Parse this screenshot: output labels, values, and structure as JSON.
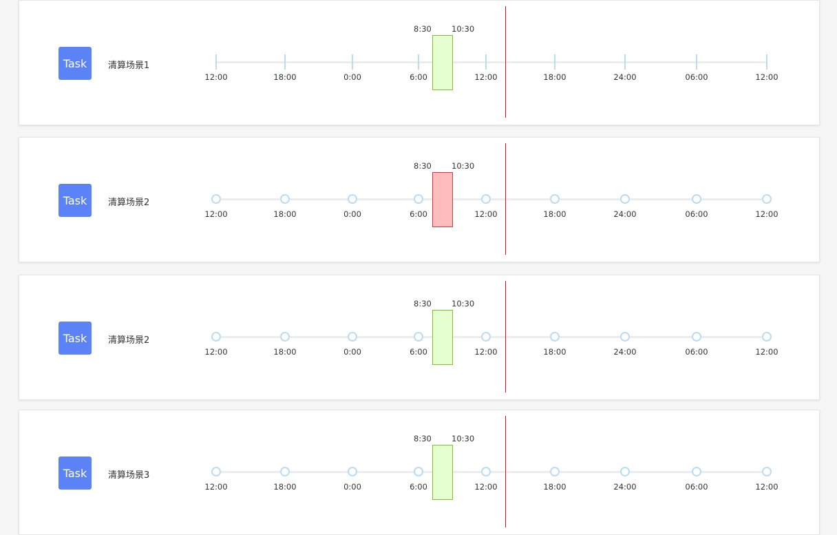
{
  "rows": [
    {
      "task_label": "Task",
      "scene_name": "清算场景1",
      "marker_style": "tick",
      "block_status": "ok",
      "block_start": "8:30",
      "block_end": "10:30",
      "ticks": [
        "12:00",
        "18:00",
        "0:00",
        "6:00",
        "12:00",
        "18:00",
        "24:00",
        "06:00",
        "12:00"
      ]
    },
    {
      "task_label": "Task",
      "scene_name": "清算场景2",
      "marker_style": "dot",
      "block_status": "error",
      "block_start": "8:30",
      "block_end": "10:30",
      "ticks": [
        "12:00",
        "18:00",
        "0:00",
        "6:00",
        "12:00",
        "18:00",
        "24:00",
        "06:00",
        "12:00"
      ]
    },
    {
      "task_label": "Task",
      "scene_name": "清算场景2",
      "marker_style": "dot",
      "block_status": "ok",
      "block_start": "8:30",
      "block_end": "10:30",
      "ticks": [
        "12:00",
        "18:00",
        "0:00",
        "6:00",
        "12:00",
        "18:00",
        "24:00",
        "06:00",
        "12:00"
      ]
    },
    {
      "task_label": "Task",
      "scene_name": "清算场景3",
      "marker_style": "dot",
      "block_status": "ok",
      "block_start": "8:30",
      "block_end": "10:30",
      "ticks": [
        "12:00",
        "18:00",
        "0:00",
        "6:00",
        "12:00",
        "18:00",
        "24:00",
        "06:00",
        "12:00"
      ]
    }
  ],
  "colors": {
    "task_button": "#5b83f7",
    "tick": "#b9dcf4",
    "now_line": "#c8102e",
    "block_ok_fill": "#e6ffd0",
    "block_ok_border": "#7dc32a",
    "block_error_fill": "#ffbcbc",
    "block_error_border": "#d9363e"
  }
}
